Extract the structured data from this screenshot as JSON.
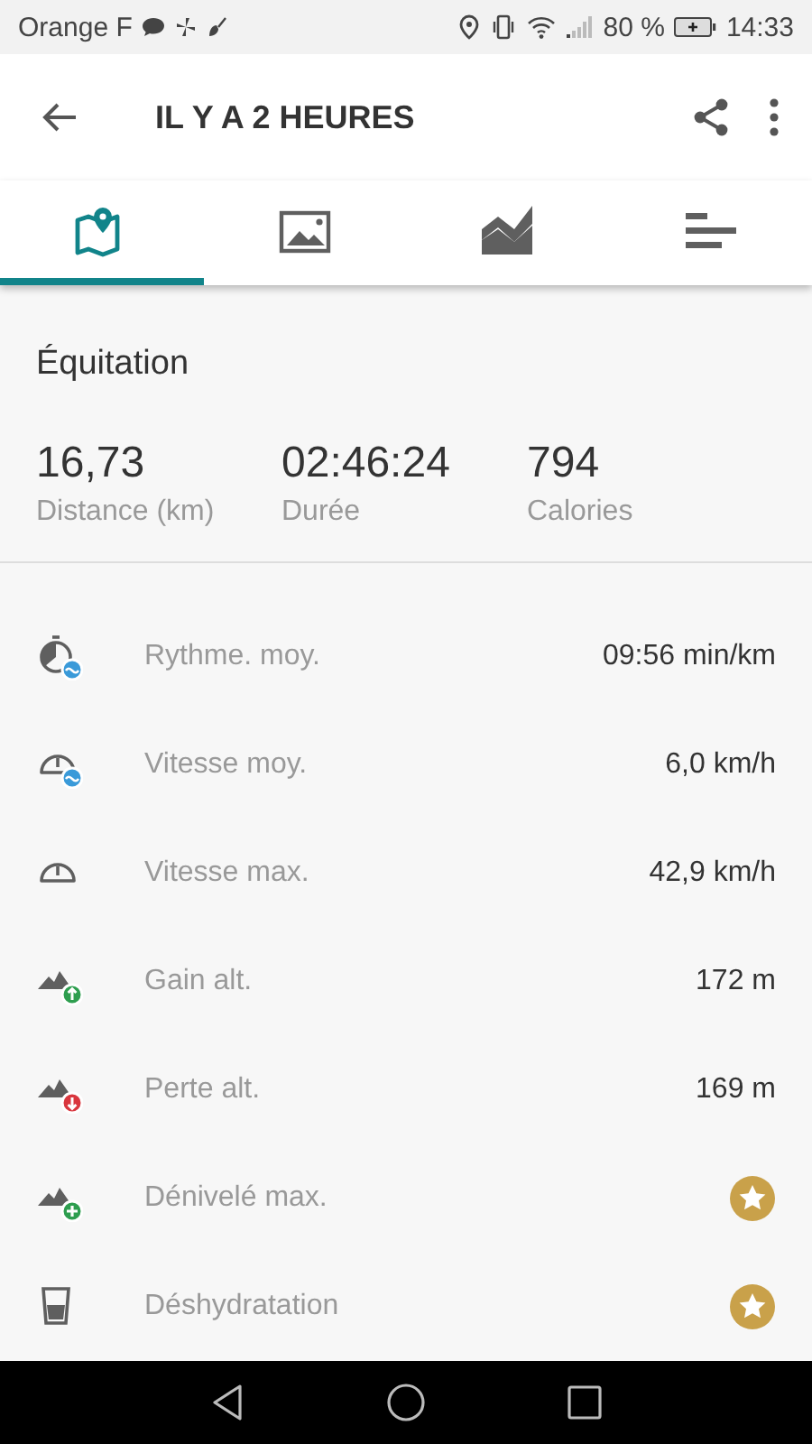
{
  "status_bar": {
    "carrier": "Orange F",
    "battery": "80 %",
    "time": "14:33"
  },
  "app_bar": {
    "title": "IL Y A 2 HEURES"
  },
  "tabs": [
    {
      "kind": "map",
      "selected": true
    },
    {
      "kind": "photo",
      "selected": false
    },
    {
      "kind": "chart",
      "selected": false
    },
    {
      "kind": "list",
      "selected": false
    }
  ],
  "activity": "Équitation",
  "summary": [
    {
      "value": "16,73",
      "label": "Distance (km)"
    },
    {
      "value": "02:46:24",
      "label": "Durée"
    },
    {
      "value": "794",
      "label": "Calories"
    }
  ],
  "stats": [
    {
      "kind": "value",
      "label": "Rythme. moy.",
      "value": "09:56 min/km"
    },
    {
      "kind": "value",
      "label": "Vitesse moy.",
      "value": "6,0 km/h"
    },
    {
      "kind": "value",
      "label": "Vitesse max.",
      "value": "42,9 km/h"
    },
    {
      "kind": "value",
      "label": "Gain alt.",
      "value": "172 m"
    },
    {
      "kind": "value",
      "label": "Perte alt.",
      "value": "169 m"
    },
    {
      "kind": "premium",
      "label": "Dénivelé max."
    },
    {
      "kind": "premium",
      "label": "Déshydratation"
    }
  ]
}
